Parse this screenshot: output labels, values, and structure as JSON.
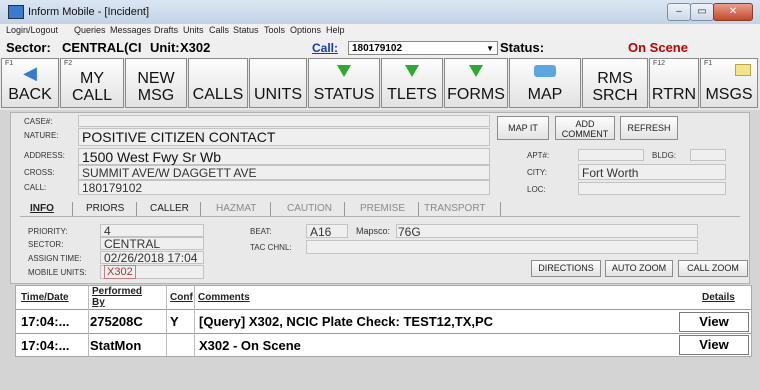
{
  "window": {
    "title": "Inform Mobile - [Incident]"
  },
  "menu": [
    "Login/Logout",
    "Queries",
    "Messages",
    "Drafts",
    "Units",
    "Calls",
    "Status",
    "Tools",
    "Options",
    "Help"
  ],
  "status_line": {
    "sector_label": "Sector:",
    "sector_value": "CENTRAL(CI",
    "unit_label": "Unit:",
    "unit_value": "X302",
    "call_label": "Call:",
    "call_value": "180179102",
    "status_label": "Status:",
    "status_value": "On Scene",
    "status_color": "#c00000"
  },
  "function_buttons": [
    {
      "key": "F1",
      "line1": "",
      "line2": "BACK",
      "icon": "back-arrow-icon"
    },
    {
      "key": "F2",
      "line1": "MY",
      "line2": "CALL",
      "icon": ""
    },
    {
      "key": "",
      "line1": "NEW",
      "line2": "MSG",
      "icon": ""
    },
    {
      "key": "",
      "line1": "",
      "line2": "CALLS",
      "icon": ""
    },
    {
      "key": "",
      "line1": "",
      "line2": "UNITS",
      "icon": ""
    },
    {
      "key": "",
      "line1": "",
      "line2": "STATUS",
      "icon": "green-triangle-icon"
    },
    {
      "key": "",
      "line1": "",
      "line2": "TLETS",
      "icon": "green-triangle-icon"
    },
    {
      "key": "",
      "line1": "",
      "line2": "FORMS",
      "icon": "green-triangle-icon"
    },
    {
      "key": "",
      "line1": "",
      "line2": "MAP",
      "icon": "map-icon"
    },
    {
      "key": "",
      "line1": "RMS",
      "line2": "SRCH",
      "icon": ""
    },
    {
      "key": "F12",
      "line1": "",
      "line2": "RTRN",
      "icon": ""
    },
    {
      "key": "F1",
      "line1": "",
      "line2": "MSGS",
      "icon": "envelope-icon"
    }
  ],
  "incident": {
    "case_label": "CASE#:",
    "case_value": "",
    "nature_label": "NATURE:",
    "nature_value": "POSITIVE CITIZEN CONTACT",
    "address_label": "ADDRESS:",
    "address_value": "1500 West Fwy Sr Wb",
    "cross_label": "CROSS:",
    "cross_value": "SUMMIT AVE/W DAGGETT AVE",
    "call_label": "CALL:",
    "call_value": "180179102",
    "apt_label": "APT#:",
    "apt_value": "",
    "bldg_label": "BLDG:",
    "bldg_value": "",
    "city_label": "CITY:",
    "city_value": "Fort Worth",
    "loc_label": "LOC:",
    "loc_value": "",
    "buttons": {
      "map_it": "MAP IT",
      "add_comment_1": "ADD",
      "add_comment_2": "COMMENT",
      "refresh": "REFRESH"
    }
  },
  "tabs": [
    {
      "label": "INFO",
      "state": "active"
    },
    {
      "label": "PRIORS",
      "state": "enabled"
    },
    {
      "label": "CALLER",
      "state": "enabled"
    },
    {
      "label": "HAZMAT",
      "state": "disabled"
    },
    {
      "label": "CAUTION",
      "state": "disabled"
    },
    {
      "label": "PREMISE",
      "state": "disabled"
    },
    {
      "label": "TRANSPORT",
      "state": "disabled"
    }
  ],
  "info": {
    "priority_label": "PRIORITY:",
    "priority_value": "4",
    "sector_label": "SECTOR:",
    "sector_value": "CENTRAL",
    "assign_label": "ASSIGN TIME:",
    "assign_value": "02/26/2018 17:04",
    "mobile_label": "MOBILE UNITS:",
    "mobile_value": "X302",
    "beat_label": "BEAT:",
    "beat_value": "A16",
    "mapsco_label": "Mapsco:",
    "mapsco_value": "76G",
    "tac_label": "TAC CHNL:",
    "tac_value": "",
    "buttons": {
      "directions": "DIRECTIONS",
      "auto_zoom": "AUTO ZOOM",
      "call_zoom": "CALL ZOOM"
    }
  },
  "comments": {
    "headers": {
      "time": "Time/Date",
      "performed_1": "Performed",
      "performed_2": "By",
      "conf": "Conf",
      "comments": "Comments",
      "details": "Details"
    },
    "rows": [
      {
        "time": "17:04:...",
        "by": "275208C",
        "conf": "Y",
        "comment": "[Query] X302, NCIC Plate Check: TEST12,TX,PC",
        "action": "View"
      },
      {
        "time": "17:04:...",
        "by": "StatMon",
        "conf": "",
        "comment": "X302 - On Scene",
        "action": "View"
      }
    ]
  }
}
